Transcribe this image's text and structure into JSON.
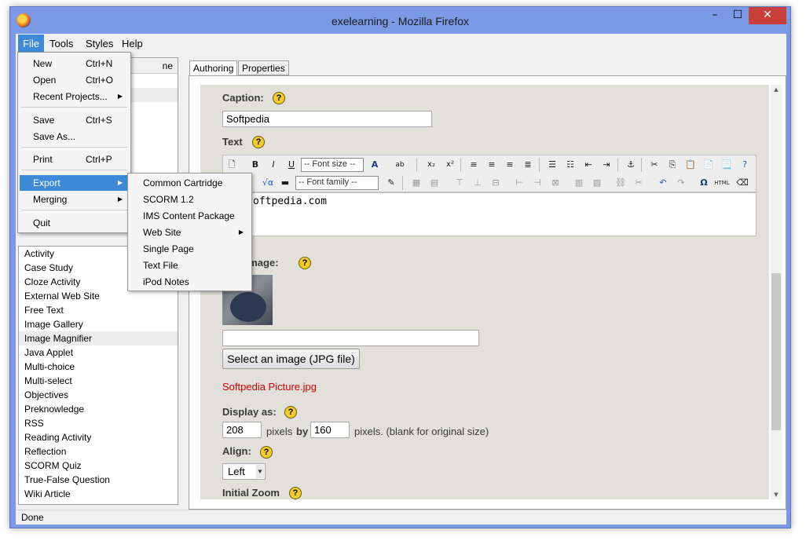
{
  "window": {
    "title": "exelearning - Mozilla Firefox",
    "buttons": {
      "minimize": "–",
      "maximize": "☐",
      "close": "✕"
    }
  },
  "menubar": [
    "File",
    "Tools",
    "Styles",
    "Help"
  ],
  "file_menu": {
    "items": [
      {
        "label": "New",
        "shortcut": "Ctrl+N"
      },
      {
        "label": "Open",
        "shortcut": "Ctrl+O"
      },
      {
        "label": "Recent Projects...",
        "submenu": true
      },
      {
        "label": "Save",
        "shortcut": "Ctrl+S"
      },
      {
        "label": "Save As..."
      },
      {
        "label": "Print",
        "shortcut": "Ctrl+P"
      },
      {
        "label": "Export",
        "submenu": true,
        "highlighted": true
      },
      {
        "label": "Merging",
        "submenu": true
      },
      {
        "label": "Quit"
      }
    ]
  },
  "export_menu": {
    "items": [
      {
        "label": "Common Cartridge"
      },
      {
        "label": "SCORM 1.2"
      },
      {
        "label": "IMS Content Package"
      },
      {
        "label": "Web Site",
        "submenu": true
      },
      {
        "label": "Single Page"
      },
      {
        "label": "Text File"
      },
      {
        "label": "iPod Notes"
      }
    ]
  },
  "outline": {
    "header_fragment": "ne"
  },
  "idevices": [
    "Activity",
    "Case Study",
    "Cloze Activity",
    "External Web Site",
    "Free Text",
    "Image Gallery",
    "Image Magnifier",
    "Java Applet",
    "Multi-choice",
    "Multi-select",
    "Objectives",
    "Preknowledge",
    "RSS",
    "Reading Activity",
    "Reflection",
    "SCORM Quiz",
    "True-False Question",
    "Wiki Article"
  ],
  "selected_idevice": "Image Magnifier",
  "tabs": [
    "Authoring",
    "Properties"
  ],
  "form": {
    "caption_label": "Caption:",
    "caption_value": "Softpedia",
    "text_label": "Text",
    "font_size_placeholder": "-- Font size --",
    "font_family_placeholder": "-- Font family --",
    "editor_text": "oftpedia.com",
    "image_label": "e an Image:",
    "select_button": "Select an image (JPG file)",
    "image_filename": "Softpedia Picture.jpg",
    "display_as_label": "Display as:",
    "width_value": "208",
    "pixels_by": "pixels",
    "by": "by",
    "height_value": "160",
    "pixels_note": "pixels. (blank for original size)",
    "align_label": "Align:",
    "align_value": "Left",
    "initial_zoom_label": "Initial Zoom",
    "help_glyph": "?"
  },
  "statusbar": "Done",
  "colors": {
    "accent": "#3e8ad8",
    "titlebar": "#7a9ae6",
    "close": "#c7403a",
    "filename": "#d40000"
  }
}
